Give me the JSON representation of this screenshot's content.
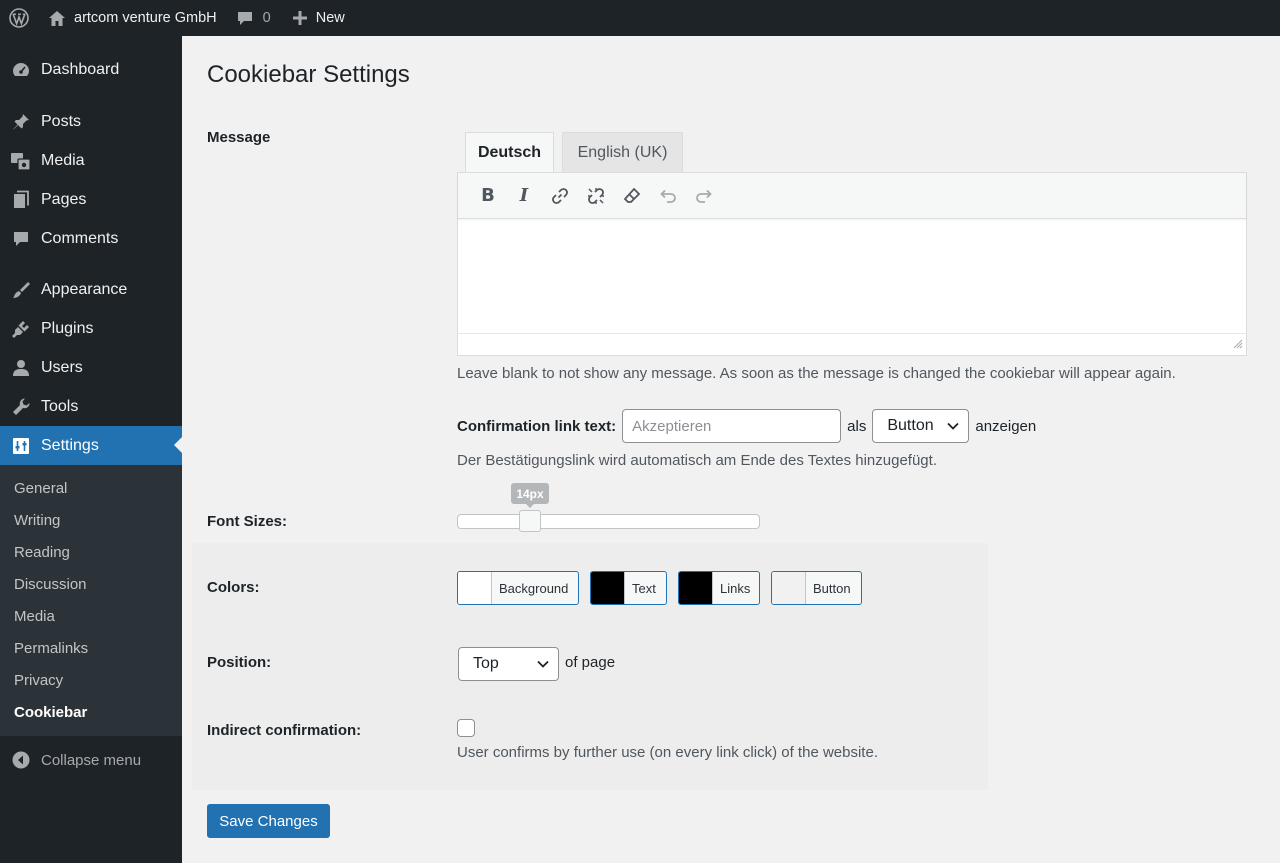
{
  "adminbar": {
    "site_name": "artcom venture GmbH",
    "comments_count": "0",
    "new_label": "New"
  },
  "sidebar": {
    "items": [
      {
        "label": "Dashboard",
        "icon": "dashboard-icon"
      },
      {
        "label": "Posts",
        "icon": "pin-icon"
      },
      {
        "label": "Media",
        "icon": "media-icon"
      },
      {
        "label": "Pages",
        "icon": "pages-icon"
      },
      {
        "label": "Comments",
        "icon": "comment-icon"
      },
      {
        "label": "Appearance",
        "icon": "paintbrush-icon"
      },
      {
        "label": "Plugins",
        "icon": "plug-icon"
      },
      {
        "label": "Users",
        "icon": "user-icon"
      },
      {
        "label": "Tools",
        "icon": "wrench-icon"
      },
      {
        "label": "Settings",
        "icon": "settings-icon"
      }
    ],
    "submenu": [
      "General",
      "Writing",
      "Reading",
      "Discussion",
      "Media",
      "Permalinks",
      "Privacy",
      "Cookiebar"
    ],
    "collapse_label": "Collapse menu"
  },
  "page": {
    "title": "Cookiebar Settings",
    "message_label": "Message",
    "tabs": [
      "Deutsch",
      "English (UK)"
    ],
    "message_help": "Leave blank to not show any message. As soon as the message is changed the cookiebar will appear again.",
    "confirmation": {
      "label": "Confirmation link text:",
      "placeholder": "Akzeptieren",
      "als": "als",
      "select_value": "Button",
      "anzeigen": "anzeigen",
      "help": "Der Bestätigungslink wird automatisch am Ende des Textes hinzugefügt."
    },
    "font_sizes": {
      "label": "Font Sizes:",
      "value_label": "14px",
      "value": 14,
      "slider_fraction": 0.22
    },
    "colors": {
      "label": "Colors:",
      "items": [
        {
          "label": "Background",
          "color": "#ffffff"
        },
        {
          "label": "Text",
          "color": "#000000"
        },
        {
          "label": "Links",
          "color": "#000000"
        },
        {
          "label": "Button",
          "color": "#f1f1f1"
        }
      ]
    },
    "position": {
      "label": "Position:",
      "select_value": "Top",
      "suffix": "of page"
    },
    "indirect": {
      "label": "Indirect confirmation:",
      "checked": false,
      "help": "User confirms by further use (on every link click) of the website."
    },
    "save_label": "Save Changes"
  },
  "colors": {
    "accent": "#2271b1",
    "adminbar_bg": "#1d2327",
    "submenu_bg": "#2c3338"
  }
}
